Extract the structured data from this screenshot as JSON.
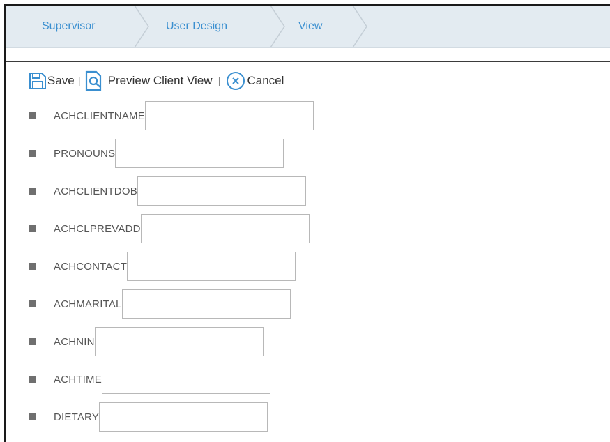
{
  "breadcrumb": [
    {
      "label": "Supervisor"
    },
    {
      "label": "User Design"
    },
    {
      "label": "View"
    }
  ],
  "toolbar": {
    "save_label": "Save",
    "separator": "|",
    "preview_label": "Preview Client View",
    "cancel_label": "Cancel"
  },
  "fields": [
    {
      "label": "ACHCLIENTNAME",
      "value": ""
    },
    {
      "label": "PRONOUNS",
      "value": ""
    },
    {
      "label": "ACHCLIENTDOB",
      "value": ""
    },
    {
      "label": "ACHCLPREVADD",
      "value": ""
    },
    {
      "label": "ACHCONTACT",
      "value": ""
    },
    {
      "label": "ACHMARITAL",
      "value": ""
    },
    {
      "label": "ACHNIN",
      "value": ""
    },
    {
      "label": "ACHTIME",
      "value": ""
    },
    {
      "label": "DIETARY",
      "value": ""
    }
  ],
  "colors": {
    "accent": "#3a8fd0",
    "breadcrumb_bg": "#e3ebf1",
    "bullet": "#6f6f6f"
  }
}
